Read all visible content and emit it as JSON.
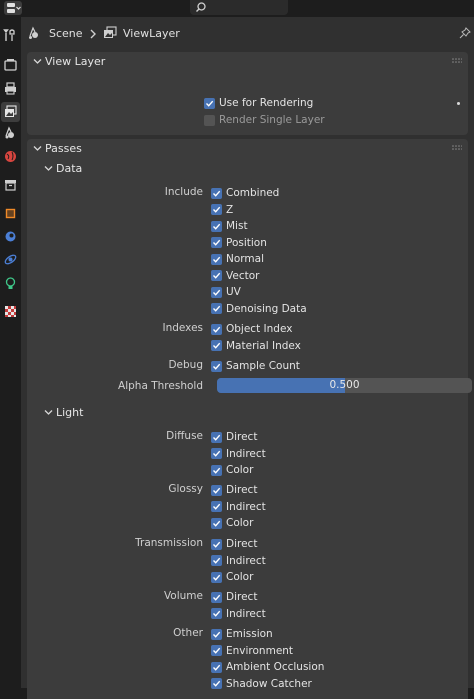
{
  "breadcrumb": {
    "scene": "Scene",
    "separator": "›",
    "view_layer": "ViewLayer"
  },
  "view_layer_panel": {
    "title": "View Layer",
    "use_for_rendering": {
      "label": "Use for Rendering",
      "checked": true
    },
    "render_single_layer": {
      "label": "Render Single Layer",
      "checked": false
    }
  },
  "passes_panel": {
    "title": "Passes",
    "data": {
      "title": "Data",
      "include_label": "Include",
      "include": [
        "Combined",
        "Z",
        "Mist",
        "Position",
        "Normal",
        "Vector",
        "UV",
        "Denoising Data"
      ],
      "indexes_label": "Indexes",
      "indexes": [
        "Object Index",
        "Material Index"
      ],
      "debug_label": "Debug",
      "debug": [
        "Sample Count"
      ],
      "alpha_threshold": {
        "label": "Alpha Threshold",
        "value": "0.500",
        "fraction": 0.5
      }
    },
    "light": {
      "title": "Light",
      "diffuse_label": "Diffuse",
      "diffuse": [
        "Direct",
        "Indirect",
        "Color"
      ],
      "glossy_label": "Glossy",
      "glossy": [
        "Direct",
        "Indirect",
        "Color"
      ],
      "transmission_label": "Transmission",
      "transmission": [
        "Direct",
        "Indirect",
        "Color"
      ],
      "volume_label": "Volume",
      "volume": [
        "Direct",
        "Indirect"
      ],
      "other_label": "Other",
      "other": [
        "Emission",
        "Environment",
        "Ambient Occlusion",
        "Shadow Catcher"
      ]
    }
  },
  "sidebar_tabs": [
    "tool",
    "render",
    "output",
    "view-layer",
    "scene",
    "world",
    "collection",
    "object",
    "modifiers",
    "particles",
    "physics",
    "object-data",
    "texture"
  ],
  "colors": {
    "accent": "#4772b3",
    "panel": "#3c3c3c",
    "background": "#303030"
  }
}
